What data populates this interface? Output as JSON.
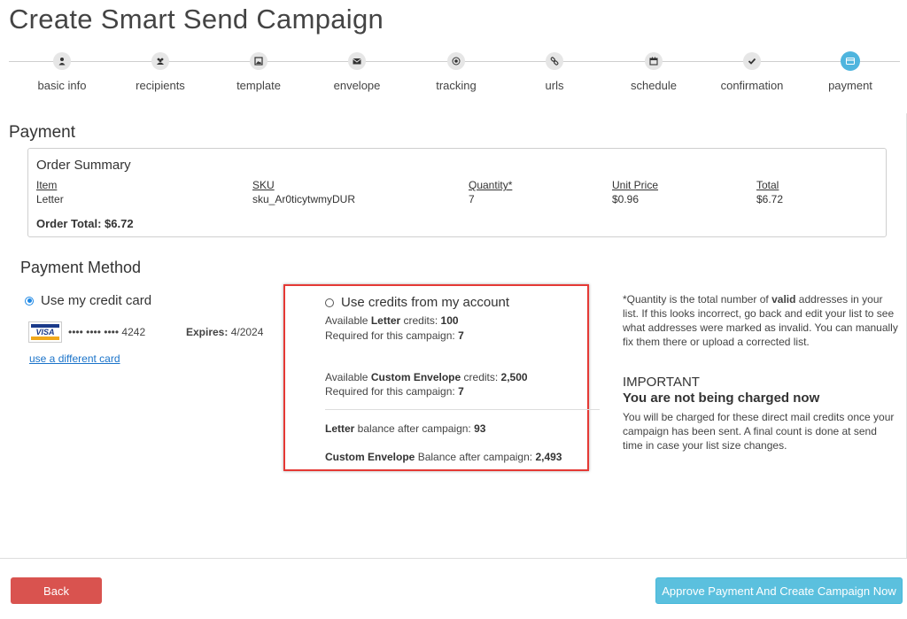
{
  "page": {
    "title": "Create Smart Send Campaign"
  },
  "steps": [
    {
      "label": "basic info",
      "icon": "user-icon"
    },
    {
      "label": "recipients",
      "icon": "users-icon"
    },
    {
      "label": "template",
      "icon": "image-icon"
    },
    {
      "label": "envelope",
      "icon": "envelope-icon"
    },
    {
      "label": "tracking",
      "icon": "target-icon"
    },
    {
      "label": "urls",
      "icon": "link-icon"
    },
    {
      "label": "schedule",
      "icon": "calendar-icon"
    },
    {
      "label": "confirmation",
      "icon": "check-icon"
    },
    {
      "label": "payment",
      "icon": "credit-card-icon",
      "active": true
    }
  ],
  "payment": {
    "section_title": "Payment",
    "order_summary": {
      "title": "Order Summary",
      "headers": [
        "Item",
        "SKU",
        "Quantity*",
        "Unit Price",
        "Total"
      ],
      "rows": [
        [
          "Letter",
          "sku_Ar0ticytwmyDUR",
          "7",
          "$0.96",
          "$6.72"
        ]
      ],
      "total_label": "Order Total: $6.72"
    },
    "method": {
      "title": "Payment Method",
      "credit_card": {
        "label": "Use my credit card",
        "selected": true,
        "card_brand": "VISA",
        "masked_number": "•••• •••• •••• 4242",
        "expires_label": "Expires:",
        "expires_value": "4/2024",
        "change_link": "use a different card"
      },
      "credits": {
        "label": "Use credits from my account",
        "selected": false,
        "lines": [
          {
            "pre": "Available ",
            "bold": "Letter",
            "mid": " credits: ",
            "value": "100"
          },
          {
            "pre": "Required for this campaign: ",
            "bold": "",
            "mid": "",
            "value": "7"
          },
          {
            "pre": "Available ",
            "bold": "Custom Envelope",
            "mid": " credits: ",
            "value": "2,500"
          },
          {
            "pre": "Required for this campaign: ",
            "bold": "",
            "mid": "",
            "value": "7"
          },
          {
            "pre": "",
            "bold": "Letter",
            "mid": " balance after campaign: ",
            "value": "93"
          },
          {
            "pre": "",
            "bold": "Custom Envelope",
            "mid": " Balance after campaign: ",
            "value": "2,493"
          }
        ]
      }
    },
    "note": {
      "pre": "*Quantity is the total number of ",
      "bold": "valid",
      "post": " addresses in your list. If this looks incorrect, go back and edit your list to see what addresses were marked as invalid. You can manually fix them there or upload a corrected list."
    },
    "important": {
      "title": "IMPORTANT",
      "subtitle": "You are not being charged now",
      "text": "You will be charged for these direct mail credits once your campaign has been sent. A final count is done at send time in case your list size changes."
    }
  },
  "footer": {
    "back_label": "Back",
    "approve_label": "Approve Payment And Create Campaign Now"
  },
  "colors": {
    "accent": "#5bc0de",
    "danger": "#d9534f",
    "highlight": "#e53935",
    "link": "#1a73c9"
  }
}
